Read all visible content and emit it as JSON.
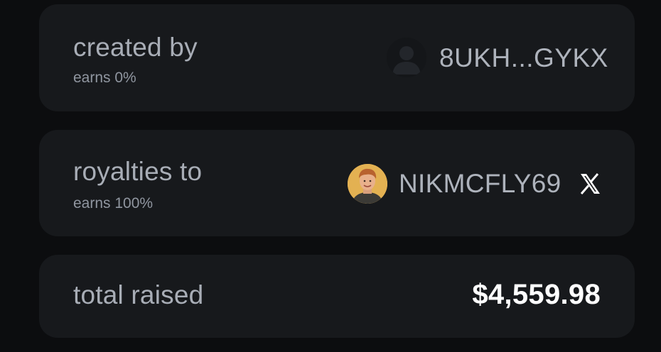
{
  "created": {
    "label": "created by",
    "earns": "earns 0%",
    "address": "8UKH...GYKX",
    "avatar_icon": "default-user-icon"
  },
  "royalties": {
    "label": "royalties to",
    "earns": "earns 100%",
    "handle": "NIKMCFLY69",
    "avatar_icon": "user-photo",
    "social_icon": "x-logo-icon"
  },
  "raised": {
    "label": "total raised",
    "amount": "$4,559.98"
  },
  "colors": {
    "background": "#0c0d0f",
    "card": "#17191c",
    "label": "#a8adb6",
    "value": "#ffffff",
    "avatar_bg": "#e3b152"
  }
}
